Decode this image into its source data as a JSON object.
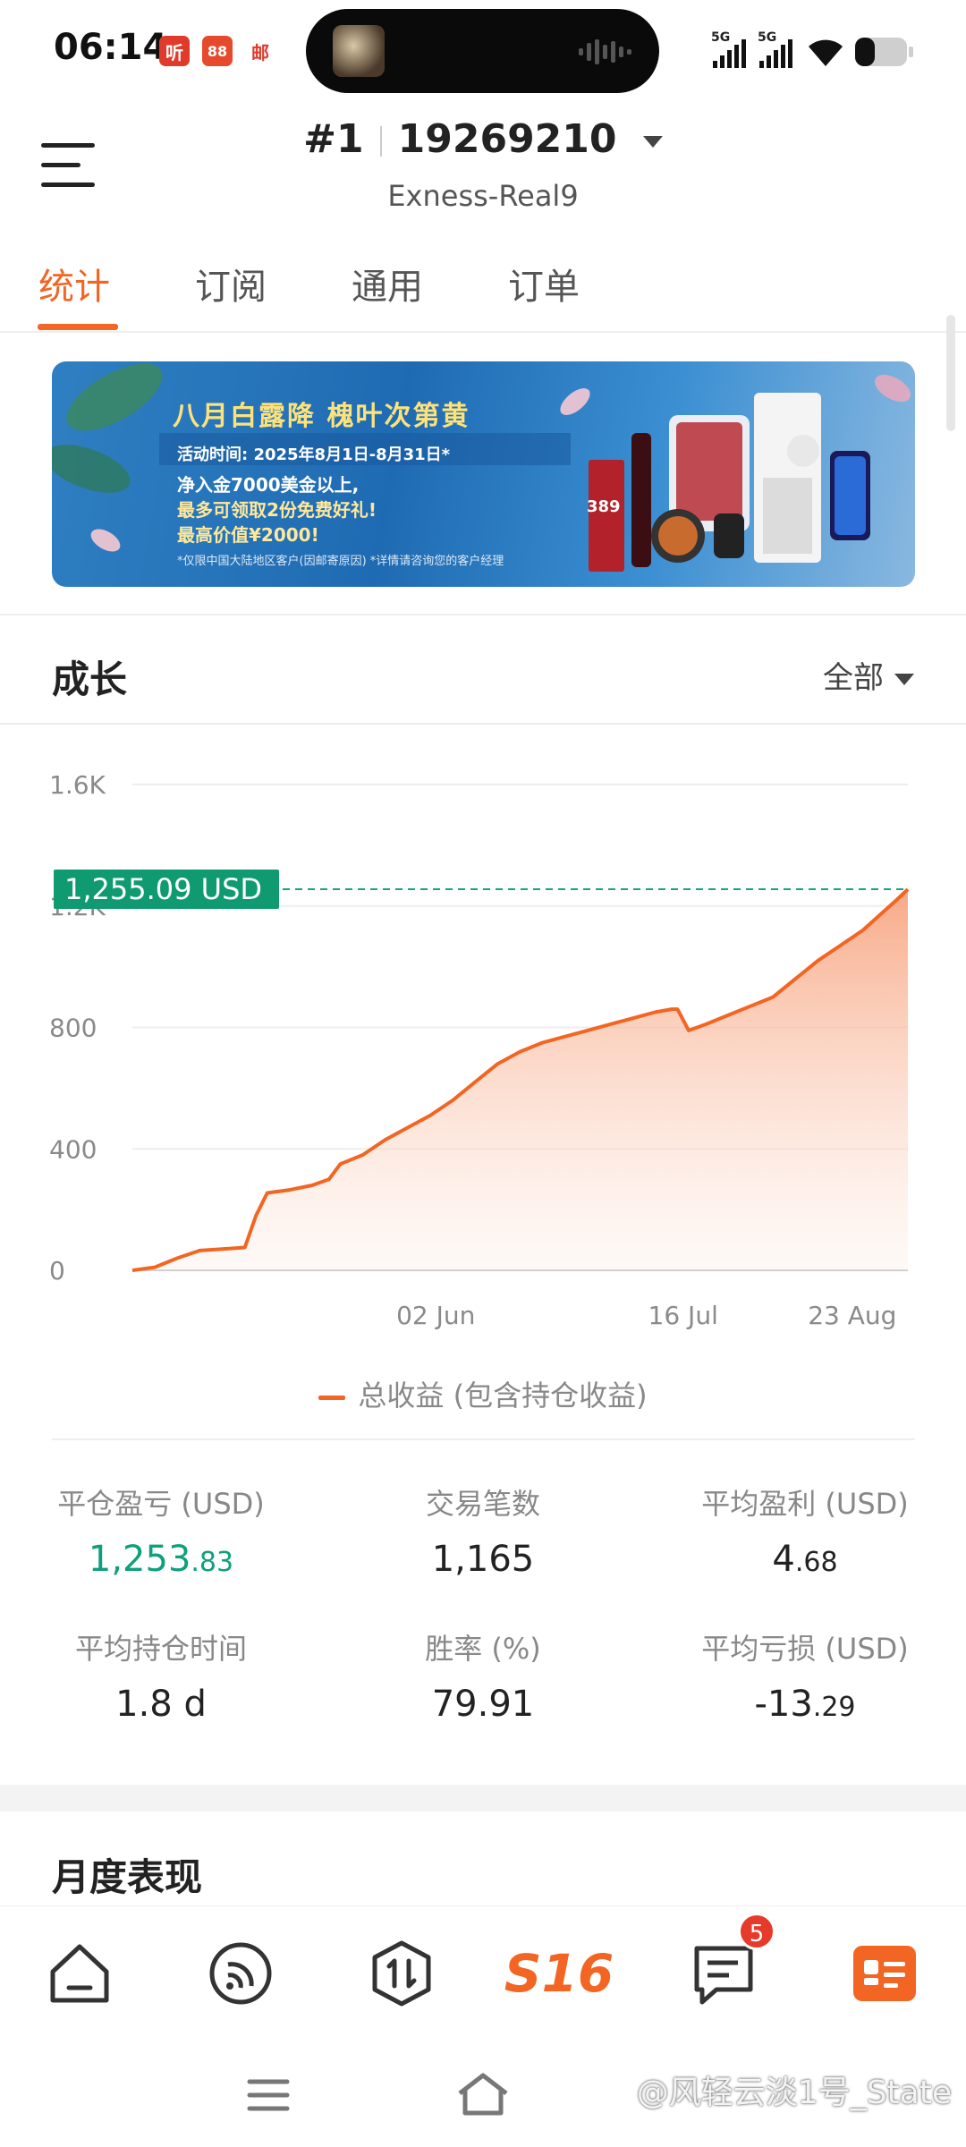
{
  "status_bar": {
    "time": "06:14",
    "app_icons": [
      "听",
      "88",
      "邮"
    ],
    "signal_labels": [
      "5G",
      "5G"
    ],
    "icons": [
      "signal-icon",
      "signal-icon",
      "wifi-icon",
      "battery-icon"
    ]
  },
  "header": {
    "account_prefix": "#1",
    "account_number": "19269210",
    "server": "Exness-Real9"
  },
  "tabs": [
    {
      "label": "统计",
      "active": true
    },
    {
      "label": "订阅",
      "active": false
    },
    {
      "label": "通用",
      "active": false
    },
    {
      "label": "订单",
      "active": false
    }
  ],
  "banner": {
    "title": "八月白露降  槐叶次第黄",
    "date": "活动时间: 2025年8月1日-8月31日*",
    "lines": [
      "净入金7000美金以上,",
      "最多可领取2份免费好礼!",
      "最高价值¥2000!"
    ],
    "note": "*仅限中国大陆地区客户(因邮寄原因)  *详情请咨询您的客户经理",
    "tag": "389"
  },
  "growth": {
    "title": "成长",
    "filter": "全部"
  },
  "chart_data": {
    "type": "area",
    "title": "",
    "xlabel": "",
    "ylabel": "",
    "ylim": [
      0,
      1600
    ],
    "yticks": [
      "0",
      "400",
      "800",
      "1.2K",
      "1.6K"
    ],
    "xticks": [
      "02 Jun",
      "16 Jul",
      "23 Aug"
    ],
    "current_value_label": "1,255.09 USD",
    "current_value": 1255.09,
    "series": [
      {
        "name": "总收益 (包含持仓收益)",
        "color": "#f26522",
        "x": [
          "2025-04-09",
          "2025-04-13",
          "2025-04-17",
          "2025-04-21",
          "2025-04-25",
          "2025-04-29",
          "2025-05-01",
          "2025-05-03",
          "2025-05-07",
          "2025-05-11",
          "2025-05-14",
          "2025-05-16",
          "2025-05-20",
          "2025-05-24",
          "2025-05-28",
          "2025-06-01",
          "2025-06-05",
          "2025-06-09",
          "2025-06-13",
          "2025-06-17",
          "2025-06-21",
          "2025-06-25",
          "2025-06-29",
          "2025-07-03",
          "2025-07-07",
          "2025-07-11",
          "2025-07-14",
          "2025-07-15",
          "2025-07-17",
          "2025-07-20",
          "2025-07-24",
          "2025-07-28",
          "2025-08-01",
          "2025-08-05",
          "2025-08-09",
          "2025-08-13",
          "2025-08-17",
          "2025-08-20",
          "2025-08-23",
          "2025-08-25"
        ],
        "values": [
          0,
          10,
          40,
          65,
          70,
          75,
          180,
          255,
          265,
          280,
          300,
          350,
          380,
          430,
          470,
          510,
          560,
          620,
          680,
          720,
          750,
          770,
          790,
          810,
          830,
          850,
          860,
          860,
          790,
          810,
          840,
          870,
          900,
          960,
          1020,
          1070,
          1120,
          1170,
          1220,
          1255
        ]
      }
    ]
  },
  "legend": {
    "label": "总收益 (包含持仓收益)"
  },
  "stats": [
    {
      "label": "平仓盈亏 (USD)",
      "int": "1,253",
      "dec": ".83",
      "positive": true
    },
    {
      "label": "交易笔数",
      "int": "1,165",
      "dec": "",
      "positive": false
    },
    {
      "label": "平均盈利 (USD)",
      "int": "4",
      "dec": ".68",
      "positive": false
    },
    {
      "label": "平均持仓时间",
      "int": "1.8 d",
      "dec": "",
      "positive": false
    },
    {
      "label": "胜率 (%)",
      "int": "79.91",
      "dec": "",
      "positive": false
    },
    {
      "label": "平均亏损 (USD)",
      "int": "-13",
      "dec": ".29",
      "positive": false
    }
  ],
  "monthly": {
    "title": "月度表现"
  },
  "bottom_nav": {
    "items": [
      "home-icon",
      "signals-icon",
      "trade-icon",
      "s16-logo",
      "messages-icon",
      "account-card-icon"
    ],
    "logo_text": "S16",
    "badge": "5"
  },
  "watermark": "@风轻云淡1号_State"
}
